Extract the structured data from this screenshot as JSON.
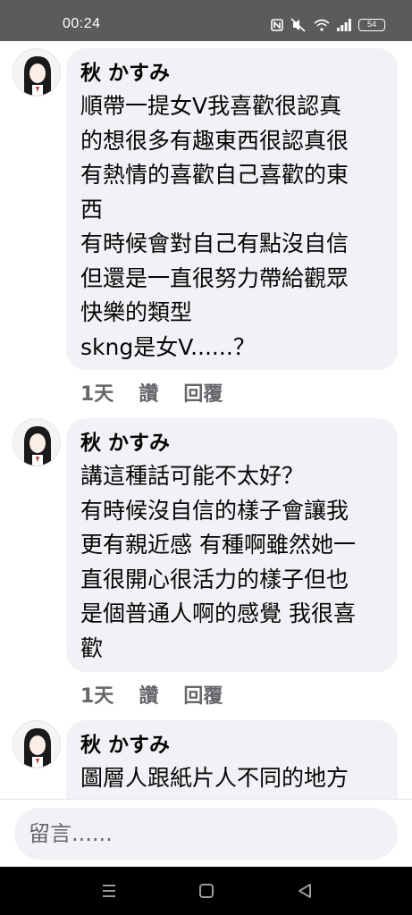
{
  "status": {
    "time": "00:24",
    "battery": "54"
  },
  "comments": [
    {
      "author": "秋 かすみ",
      "text": "順帶一提女V我喜歡很認真\n的想很多有趣東西很認真很\n有熱情的喜歡自己喜歡的東\n西\n有時候會對自己有點沒自信\n但還是一直很努力帶給觀眾\n快樂的類型\nskng是女V......？",
      "time": "1天",
      "like": "讚",
      "reply": "回覆"
    },
    {
      "author": "秋 かすみ",
      "text": "講這種話可能不太好？\n有時候沒自信的樣子會讓我\n更有親近感 有種啊雖然她一\n直很開心很活力的樣子但也\n是個普通人啊的感覺 我很喜\n歡",
      "time": "1天",
      "like": "讚",
      "reply": "回覆"
    },
    {
      "author": "秋 かすみ",
      "text": "圖層人跟紙片人不同的地方"
    }
  ],
  "composer": {
    "placeholder": "留言......"
  },
  "nav": {
    "icons": [
      "menu-icon",
      "home-icon",
      "back-icon"
    ]
  },
  "colors": {
    "bubble": "#f0f2f5",
    "meta": "#65676b",
    "statusbar": "#5b5b5b"
  }
}
